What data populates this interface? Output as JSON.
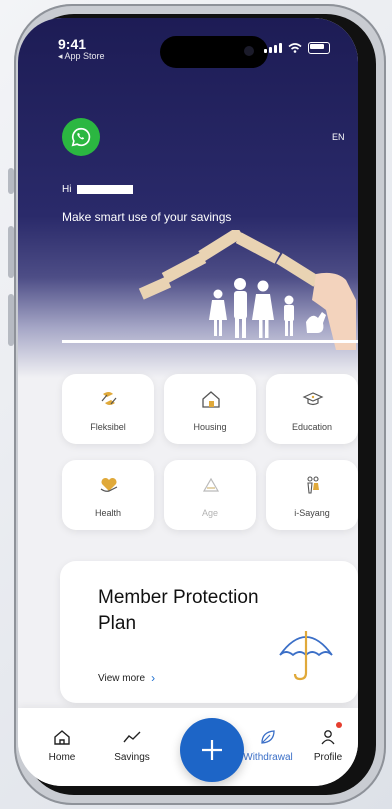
{
  "status_bar": {
    "time": "9:41",
    "back_app": "◂ App Store"
  },
  "header": {
    "whatsapp_icon": "whatsapp-icon",
    "language": "EN",
    "greeting_prefix": "Hi",
    "tagline": "Make smart use of your savings"
  },
  "categories": [
    {
      "label": "Fleksibel",
      "icon": "flexible-icon"
    },
    {
      "label": "Housing",
      "icon": "house-icon"
    },
    {
      "label": "Education",
      "icon": "graduation-cap-icon"
    },
    {
      "label": "Health",
      "icon": "heart-hand-icon"
    },
    {
      "label": "Age",
      "icon": "age-icon"
    },
    {
      "label": "i-Sayang",
      "icon": "couple-icon"
    }
  ],
  "promo_card": {
    "title": "Member Protection Plan",
    "link": "View more",
    "icon": "umbrella-icon"
  },
  "bottom_nav": {
    "items": [
      {
        "label": "Home",
        "icon": "home-icon"
      },
      {
        "label": "Savings",
        "icon": "trend-icon"
      },
      {
        "label": "Withdrawal",
        "icon": "leaf-icon"
      },
      {
        "label": "Profile",
        "icon": "person-icon"
      }
    ],
    "fab_icon": "plus-icon",
    "active": "Withdrawal"
  },
  "colors": {
    "hero_top": "#1d1c55",
    "accent_blue": "#1d65c7",
    "whatsapp_green": "#2bb741",
    "notification_red": "#e53e2f"
  }
}
